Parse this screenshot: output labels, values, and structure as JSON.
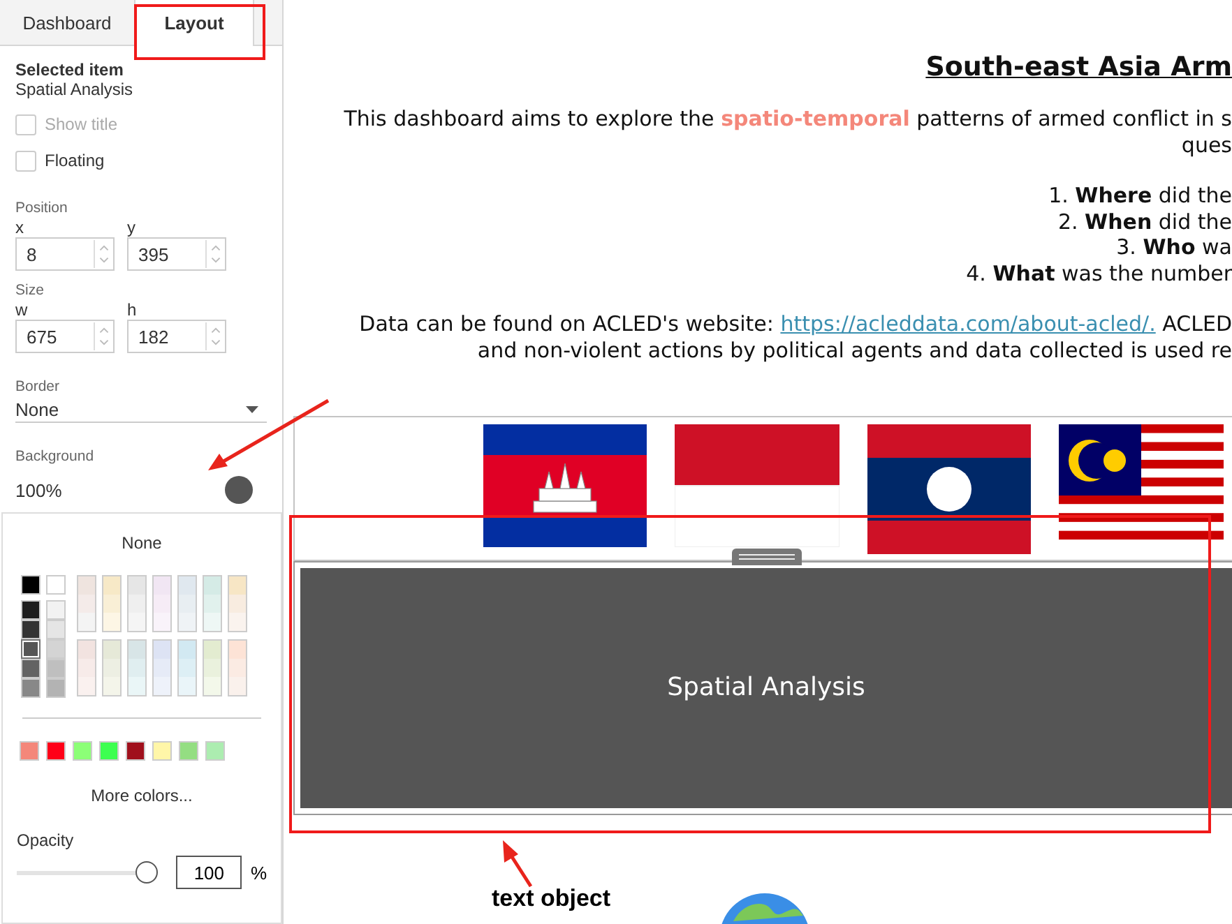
{
  "sidebar": {
    "tabs": [
      {
        "label": "Dashboard",
        "selected": false
      },
      {
        "label": "Layout",
        "selected": true
      }
    ],
    "selected_item": {
      "heading": "Selected item",
      "value": "Spatial Analysis"
    },
    "options": [
      {
        "label": "Show title",
        "checked": false,
        "disabled": true
      },
      {
        "label": "Floating",
        "checked": false,
        "disabled": false
      }
    ],
    "position": {
      "label": "Position",
      "fields": [
        {
          "label": "x",
          "value": "8"
        },
        {
          "label": "y",
          "value": "395"
        }
      ]
    },
    "size": {
      "label": "Size",
      "fields": [
        {
          "label": "w",
          "value": "675"
        },
        {
          "label": "h",
          "value": "182"
        }
      ]
    },
    "border": {
      "label": "Border",
      "value": "None"
    },
    "background": {
      "label": "Background",
      "opacity": "100%",
      "color": "#555555"
    }
  },
  "color_picker": {
    "none_label": "None",
    "gray_columns": [
      {
        "top": {
          "color": "#000000"
        },
        "shades": [
          {
            "color": "#1e1e1e",
            "selected": false
          },
          {
            "color": "#333333",
            "selected": false
          },
          {
            "color": "#555555",
            "selected": true
          },
          {
            "color": "#636363",
            "selected": false
          },
          {
            "color": "#888888",
            "selected": false
          }
        ]
      },
      {
        "top": {
          "color": "#ffffff"
        },
        "shades": [
          {
            "color": "#f2f2f2",
            "selected": false
          },
          {
            "color": "#e5e5e5",
            "selected": false
          },
          {
            "color": "#d4d4d4",
            "selected": false
          },
          {
            "color": "#bfbfbf",
            "selected": false
          },
          {
            "color": "#b3b3b3",
            "selected": false
          }
        ]
      }
    ],
    "pastels": [
      {
        "shades": [
          {
            "color": "#efe4df"
          },
          {
            "color": "#f4ebe9"
          },
          {
            "color": "#f4f4f4"
          }
        ]
      },
      {
        "shades": [
          {
            "color": "#f7e9c7"
          },
          {
            "color": "#f9efd6"
          },
          {
            "color": "#fdf6e5"
          }
        ]
      },
      {
        "shades": [
          {
            "color": "#e6e6e6"
          },
          {
            "color": "#efefef"
          },
          {
            "color": "#f5f5f5"
          }
        ]
      },
      {
        "shades": [
          {
            "color": "#f1e6f3"
          },
          {
            "color": "#f6ecf6"
          },
          {
            "color": "#f9f3fa"
          }
        ]
      },
      {
        "shades": [
          {
            "color": "#e0e8ef"
          },
          {
            "color": "#e8eef2"
          },
          {
            "color": "#eff3f6"
          }
        ]
      },
      {
        "shades": [
          {
            "color": "#d5ebe6"
          },
          {
            "color": "#e1f1ed"
          },
          {
            "color": "#eef7f5"
          }
        ]
      },
      {
        "shades": [
          {
            "color": "#f7e6c5"
          },
          {
            "color": "#f8ece0"
          },
          {
            "color": "#faf3ee"
          }
        ]
      },
      {
        "shades": [
          {
            "color": "#f2e3e0"
          },
          {
            "color": "#f7ebe9"
          },
          {
            "color": "#faf1ef"
          }
        ]
      },
      {
        "shades": [
          {
            "color": "#e6e9d8"
          },
          {
            "color": "#edefe3"
          },
          {
            "color": "#f4f5ea"
          }
        ]
      },
      {
        "shades": [
          {
            "color": "#d8e5e7"
          },
          {
            "color": "#e0eef0"
          },
          {
            "color": "#eaf6f7"
          }
        ]
      },
      {
        "shades": [
          {
            "color": "#dde3f4"
          },
          {
            "color": "#e6ebf7"
          },
          {
            "color": "#eef2fa"
          }
        ]
      },
      {
        "shades": [
          {
            "color": "#d2e9f2"
          },
          {
            "color": "#ddeff5"
          },
          {
            "color": "#eaf5f9"
          }
        ]
      },
      {
        "shades": [
          {
            "color": "#e3ecd0"
          },
          {
            "color": "#eaf1dd"
          },
          {
            "color": "#f3f8ea"
          }
        ]
      },
      {
        "shades": [
          {
            "color": "#fde3d6"
          },
          {
            "color": "#fbebe3"
          },
          {
            "color": "#faf1ec"
          }
        ]
      }
    ],
    "recent": [
      {
        "color": "#f4877a"
      },
      {
        "color": "#ff0018"
      },
      {
        "color": "#8cff77"
      },
      {
        "color": "#3dff50"
      },
      {
        "color": "#a0101c"
      },
      {
        "color": "#fff6a8"
      },
      {
        "color": "#94de82"
      },
      {
        "color": "#acedb0"
      }
    ],
    "more_colors": "More colors...",
    "opacity": {
      "label": "Opacity",
      "level": 1,
      "value": "100",
      "unit": "%"
    }
  },
  "dashboard": {
    "title": "South-east Asia Arm",
    "intro": [
      "This dashboard aims to explore the **spatio-temporal** patterns of armed conflict in s",
      "ques"
    ],
    "questions": [
      "1. **Where** did the",
      "2. **When** did the",
      "3. **Who** wa",
      "4. **What** was the number"
    ],
    "data_line": {
      "before": "Data can be found on ACLED's website:",
      "link": "https://acleddata.com/about-acled/.",
      "after": "ACLED"
    },
    "last_line": "and non-violent actions by political agents and data collected is used re",
    "text_object": {
      "label": "Spatial Analysis"
    }
  },
  "annotation": {
    "label": "text object"
  }
}
